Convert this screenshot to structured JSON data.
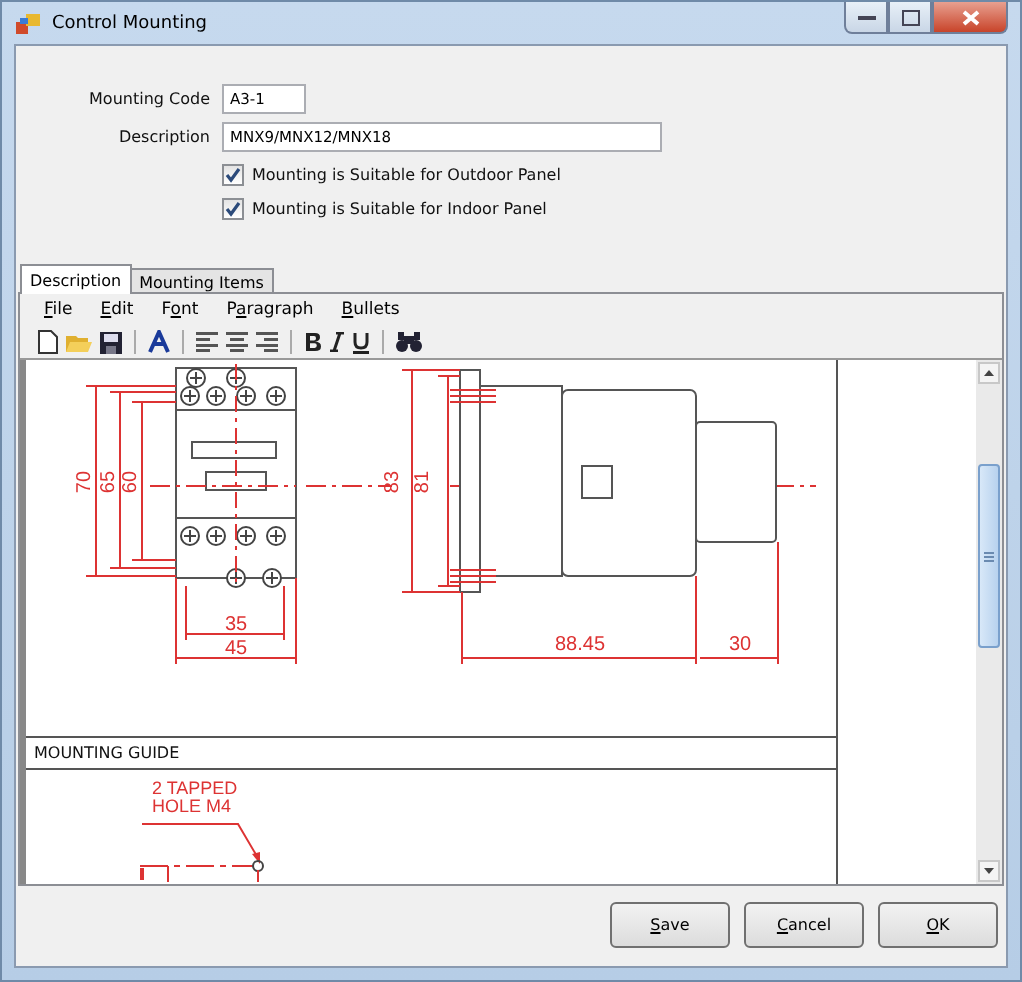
{
  "window": {
    "title": "Control Mounting"
  },
  "form": {
    "fields": [
      {
        "label": "Mounting Code",
        "value": "A3-1",
        "kind": "short"
      },
      {
        "label": "Description",
        "value": "MNX9/MNX12/MNX18",
        "kind": "long"
      }
    ],
    "checkboxes": [
      {
        "label": "Mounting is Suitable for Outdoor Panel",
        "checked": true
      },
      {
        "label": "Mounting is Suitable for Indoor Panel",
        "checked": true
      }
    ]
  },
  "tabs": [
    {
      "label": "Description",
      "selected": true
    },
    {
      "label": "Mounting Items",
      "selected": false
    }
  ],
  "menu": [
    {
      "key": "F",
      "post": "ile"
    },
    {
      "key": "E",
      "post": "dit"
    },
    {
      "pre": "F",
      "key": "o",
      "post": "nt"
    },
    {
      "pre": "P",
      "key": "a",
      "post": "ragraph"
    },
    {
      "key": "B",
      "post": "ullets"
    }
  ],
  "drawing": {
    "front_dimensions": [
      "70",
      "65",
      "60",
      "35",
      "45"
    ],
    "side_dimensions": [
      "83",
      "81",
      "88.45",
      "30"
    ]
  },
  "mounting_guide": {
    "heading": "MOUNTING GUIDE",
    "note_lines": [
      "2 TAPPED",
      "HOLE M4"
    ]
  },
  "buttons": [
    {
      "key": "S",
      "post": "ave"
    },
    {
      "key": "C",
      "post": "ancel"
    },
    {
      "key": "O",
      "post": "K"
    }
  ]
}
